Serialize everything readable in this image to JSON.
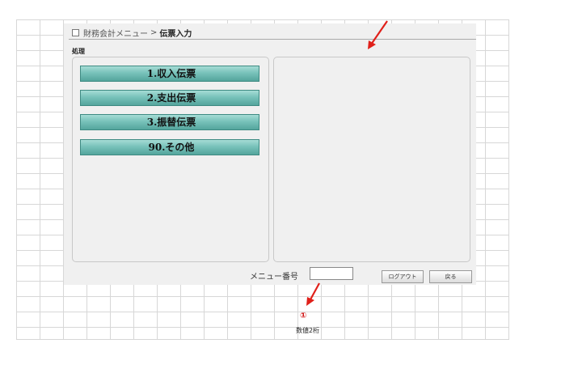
{
  "breadcrumb": {
    "parent": "財務会計メニュー",
    "separator": ">",
    "current": "伝票入力"
  },
  "section_label": "処理",
  "menu_items": [
    {
      "label": "1.収入伝票"
    },
    {
      "label": "2.支出伝票"
    },
    {
      "label": "3.振替伝票"
    },
    {
      "label": "90.その他"
    }
  ],
  "footer": {
    "menu_number_label": "メニュー番号",
    "menu_number_value": "",
    "logout_label": "ログアウト",
    "back_label": "戻る"
  },
  "annotation": {
    "number": "①",
    "text": "数値2桁"
  },
  "colors": {
    "annotation_arrow": "#e0201a",
    "menu_button": "#78c2ba"
  }
}
